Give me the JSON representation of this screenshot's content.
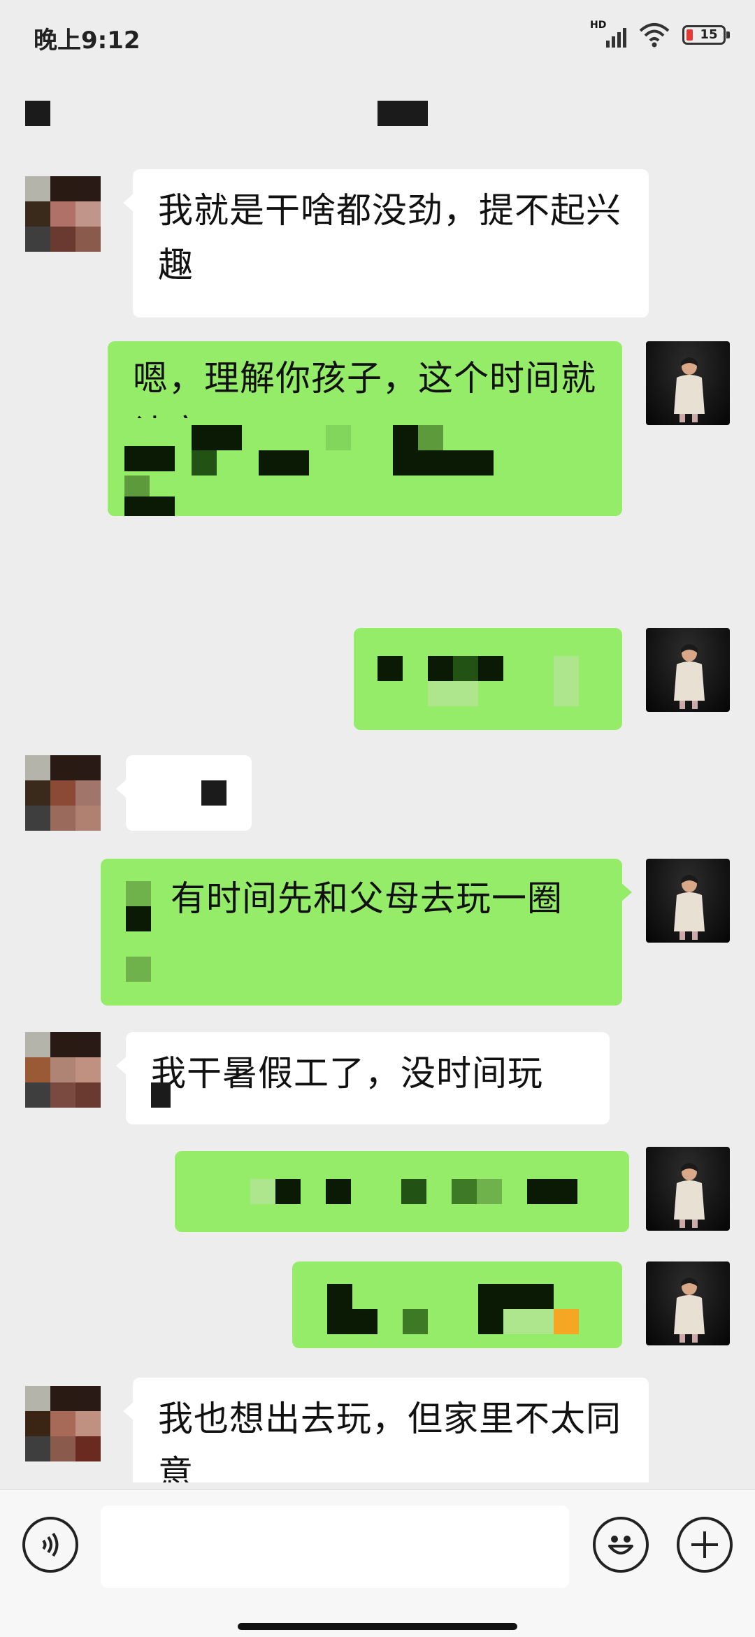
{
  "status_bar": {
    "time": "晚上9:12",
    "network_label": "HD",
    "battery_level": "15",
    "battery_color": "#e53935"
  },
  "chat": {
    "messages": [
      {
        "side": "left",
        "text": "我就是干啥都没劲，提不起兴趣"
      },
      {
        "side": "right",
        "text": "嗯，理解你孩子，这个时间就让它..."
      },
      {
        "side": "right",
        "text": ""
      },
      {
        "side": "left",
        "text": ""
      },
      {
        "side": "right",
        "text": "有时间先和父母去玩一圈"
      },
      {
        "side": "left",
        "text": "我干暑假工了，没时间玩"
      },
      {
        "side": "right",
        "text": ""
      },
      {
        "side": "right",
        "text": ""
      },
      {
        "side": "left",
        "text": "我也想出去玩，但家里不太同意"
      }
    ]
  },
  "input_bar": {
    "voice_icon": "voice-icon",
    "emoji_icon": "emoji-icon",
    "plus_icon": "plus-icon",
    "placeholder": ""
  },
  "colors": {
    "own_bubble": "#95ec69",
    "their_bubble": "#ffffff",
    "background": "#ededed"
  }
}
